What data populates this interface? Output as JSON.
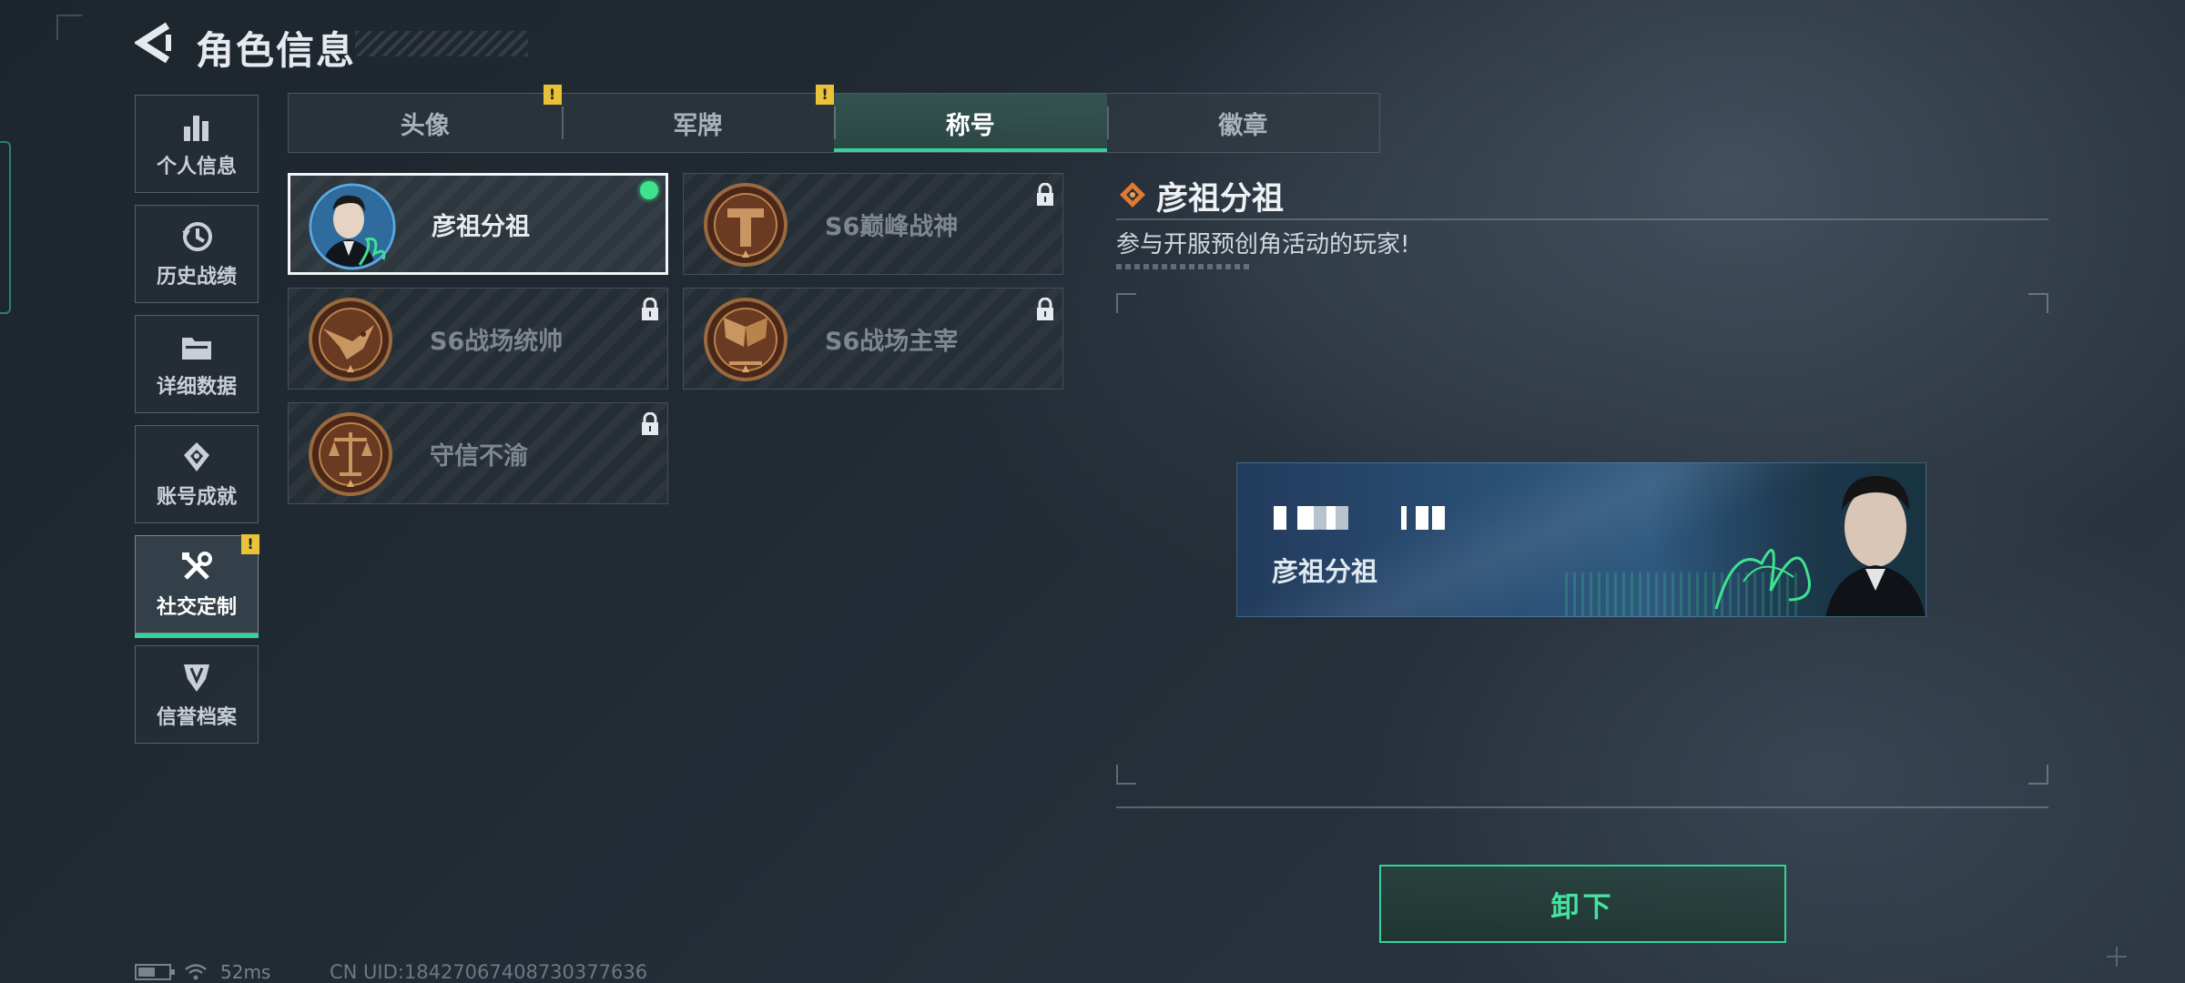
{
  "header": {
    "title": "角色信息",
    "back_icon": "back-arrow-icon"
  },
  "sidebar": {
    "items": [
      {
        "label": "个人信息",
        "icon": "bar-chart-icon",
        "active": false,
        "warn": false
      },
      {
        "label": "历史战绩",
        "icon": "clock-history-icon",
        "active": false,
        "warn": false
      },
      {
        "label": "详细数据",
        "icon": "folder-icon",
        "active": false,
        "warn": false
      },
      {
        "label": "账号成就",
        "icon": "achievement-icon",
        "active": false,
        "warn": false
      },
      {
        "label": "社交定制",
        "icon": "tools-icon",
        "active": true,
        "warn": true
      },
      {
        "label": "信誉档案",
        "icon": "credit-badge-icon",
        "active": false,
        "warn": false
      }
    ]
  },
  "tabs": [
    {
      "label": "头像",
      "active": false,
      "warn": true
    },
    {
      "label": "军牌",
      "active": false,
      "warn": true
    },
    {
      "label": "称号",
      "active": true,
      "warn": false
    },
    {
      "label": "徽章",
      "active": false,
      "warn": false
    }
  ],
  "warn_mark": "!",
  "titles": [
    {
      "name": "彦祖分祖",
      "emblem": "portrait-emblem-icon",
      "selected": true,
      "locked": false,
      "equipped": true
    },
    {
      "name": "S6巅峰战神",
      "emblem": "bronze-t-emblem-icon",
      "selected": false,
      "locked": true,
      "equipped": false
    },
    {
      "name": "S6战场统帅",
      "emblem": "bronze-eagle-emblem-icon",
      "selected": false,
      "locked": true,
      "equipped": false
    },
    {
      "name": "S6战场主宰",
      "emblem": "bronze-flags-emblem-icon",
      "selected": false,
      "locked": true,
      "equipped": false
    },
    {
      "name": "守信不渝",
      "emblem": "bronze-scales-emblem-icon",
      "selected": false,
      "locked": true,
      "equipped": false
    }
  ],
  "detail": {
    "title": "彦祖分祖",
    "description": "参与开服预创角活动的玩家!",
    "banner_name": "彦祖分祖"
  },
  "actions": {
    "unequip_label": "卸下"
  },
  "status": {
    "ping": "52ms",
    "uid": "CN UID:18427067408730377636"
  },
  "colors": {
    "accent": "#35d39a",
    "warning": "#e8c33a",
    "equipped_dot": "#3ee38e"
  }
}
